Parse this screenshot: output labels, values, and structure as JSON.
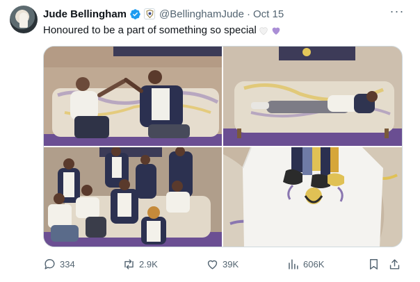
{
  "author": {
    "name": "Jude Bellingham",
    "handle": "@BellinghamJude",
    "separator": "·",
    "date": "Oct 15"
  },
  "tweet": {
    "text": "Honoured to be a part of something so special",
    "emoji": [
      "white-heart-icon",
      "purple-heart-icon"
    ]
  },
  "media": {
    "photos": [
      "photo-1",
      "photo-2",
      "photo-3",
      "photo-4"
    ]
  },
  "actions": {
    "replies": "334",
    "reposts": "2.9K",
    "likes": "39K",
    "views": "606K"
  },
  "colors": {
    "text": "#0f1419",
    "secondary": "#536471",
    "verified": "#1d9bf0",
    "border": "#cfd9de",
    "purple_heart": "#aa8ed6"
  }
}
